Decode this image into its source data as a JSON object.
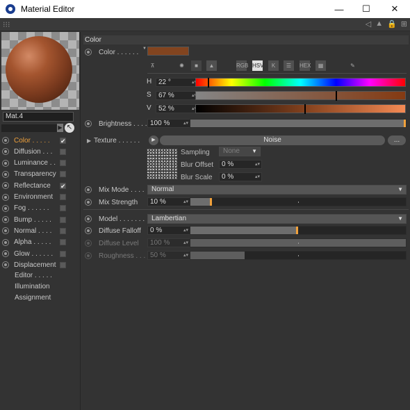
{
  "window": {
    "title": "Material Editor",
    "minimize": "—",
    "maximize": "☐",
    "close": "✕"
  },
  "toolbar": {
    "grip": "⁝⁝⁝",
    "icons": [
      "◁",
      "▲",
      "🔒",
      "⊞"
    ]
  },
  "material": {
    "name": "Mat.4"
  },
  "channels": [
    {
      "label": "Color",
      "dots": ". . . . .",
      "checked": true,
      "active": true
    },
    {
      "label": "Diffusion",
      "dots": ". . .",
      "checked": false,
      "active": false
    },
    {
      "label": "Luminance",
      "dots": ". .",
      "checked": false,
      "active": false
    },
    {
      "label": "Transparency",
      "dots": "",
      "checked": false,
      "active": false
    },
    {
      "label": "Reflectance",
      "dots": "",
      "checked": true,
      "active": false
    },
    {
      "label": "Environment",
      "dots": "",
      "checked": false,
      "active": false
    },
    {
      "label": "Fog",
      "dots": ". . . . . .",
      "checked": false,
      "active": false
    },
    {
      "label": "Bump",
      "dots": ". . . . .",
      "checked": false,
      "active": false
    },
    {
      "label": "Normal",
      "dots": ". . . .",
      "checked": false,
      "active": false
    },
    {
      "label": "Alpha",
      "dots": ". . . . .",
      "checked": false,
      "active": false
    },
    {
      "label": "Glow",
      "dots": ". . . . . .",
      "checked": false,
      "active": false
    },
    {
      "label": "Displacement",
      "dots": "",
      "checked": false,
      "active": false
    }
  ],
  "extras": [
    "Editor . . . . .",
    "Illumination",
    "Assignment"
  ],
  "section": {
    "title": "Color"
  },
  "color": {
    "label": "Color . . . . . .",
    "swatch": "#82441f",
    "mode_icons": [
      "⊼",
      "✺",
      "■",
      "▲",
      "RGB",
      "HSV",
      "K",
      "☰",
      "HEX",
      "▦",
      "✎"
    ],
    "selected_mode": "HSV",
    "h": {
      "letter": "H",
      "value": "22 °",
      "fraction": 0.06
    },
    "s": {
      "letter": "S",
      "value": "67 %",
      "fraction": 0.67
    },
    "v": {
      "letter": "V",
      "value": "52 %",
      "fraction": 0.52
    }
  },
  "brightness": {
    "label": "Brightness . . . .",
    "value": "100 %",
    "fraction": 1.0
  },
  "texture": {
    "label": "Texture . . . . . .",
    "name": "Noise",
    "more": "...",
    "play": "▶"
  },
  "noise": {
    "sampling": {
      "label": "Sampling",
      "value": "None"
    },
    "blur_offset": {
      "label": "Blur Offset",
      "value": "0 %"
    },
    "blur_scale": {
      "label": "Blur Scale",
      "value": "0 %"
    }
  },
  "mix_mode": {
    "label": "Mix Mode . . . . .",
    "value": "Normal"
  },
  "mix_strength": {
    "label": "Mix Strength",
    "value": "10 %",
    "fraction": 0.1
  },
  "model": {
    "label": "Model . . . . . . . .",
    "value": "Lambertian"
  },
  "diffuse_falloff": {
    "label": "Diffuse Falloff",
    "value": "0 %",
    "fraction": 0.5
  },
  "diffuse_level": {
    "label": "Diffuse Level",
    "value": "100 %",
    "fraction": 1.0
  },
  "roughness": {
    "label": "Roughness . . .",
    "value": "50 %",
    "fraction": 0.25
  },
  "accent": "#f0a13c"
}
